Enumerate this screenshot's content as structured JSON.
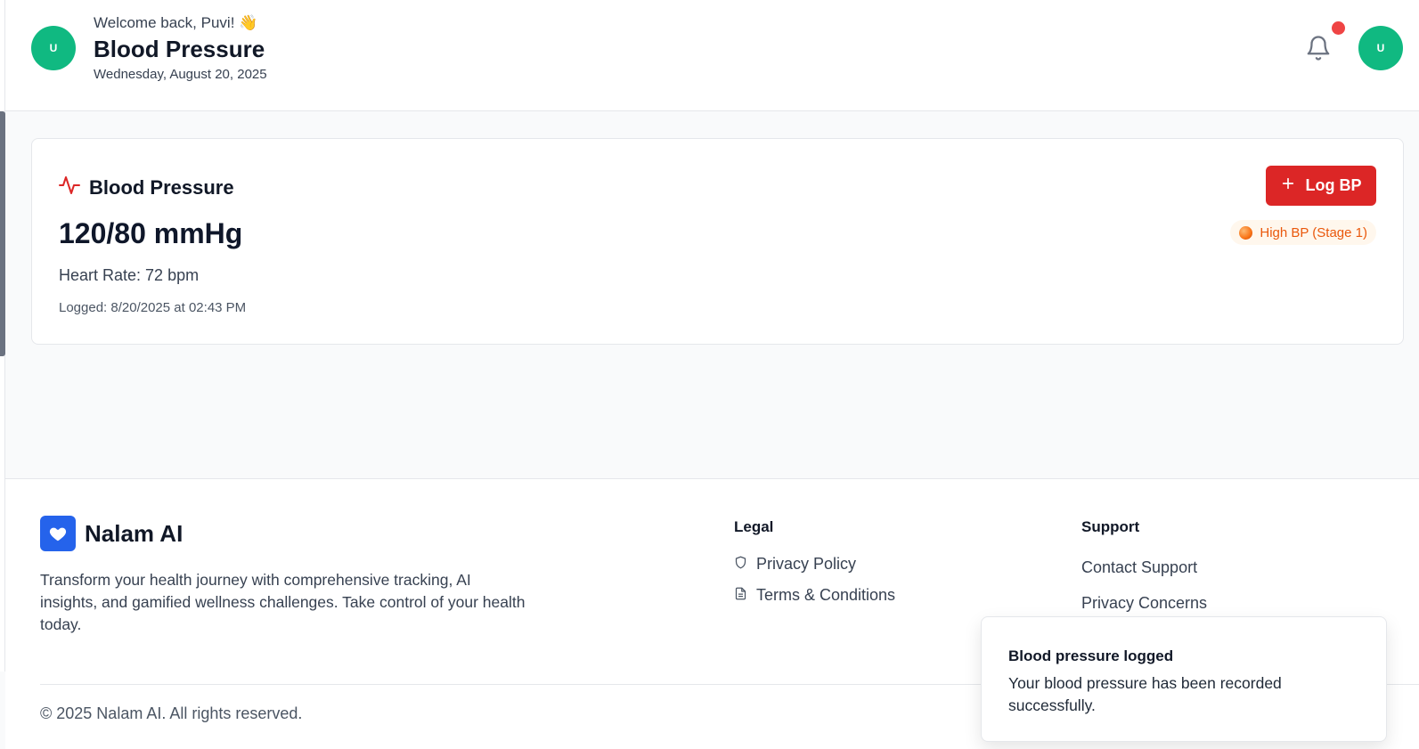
{
  "header": {
    "avatar_initial": "U",
    "welcome": "Welcome back, Puvi! 👋",
    "title": "Blood Pressure",
    "date": "Wednesday, August 20, 2025",
    "notifications_icon": "bell-icon",
    "profile_initial": "U"
  },
  "card": {
    "icon": "activity-pulse-icon",
    "heading": "Blood Pressure",
    "reading": "120/80 mmHg",
    "heart_rate": "Heart Rate: 72 bpm",
    "logged": "Logged: 8/20/2025 at 02:43 PM",
    "log_button": "Log BP",
    "status_badge": "High BP (Stage 1)"
  },
  "footer": {
    "brand_name": "Nalam AI",
    "tagline": "Transform your health journey with comprehensive tracking, AI insights, and gamified wellness challenges. Take control of your health today.",
    "legal_heading": "Legal",
    "legal_links": [
      "Privacy Policy",
      "Terms & Conditions"
    ],
    "support_heading": "Support",
    "support_links": [
      "Contact Support",
      "Privacy Concerns"
    ],
    "copyright": "© 2025 Nalam AI. All rights reserved."
  },
  "toast": {
    "title": "Blood pressure logged",
    "message": "Your blood pressure has been recorded successfully."
  },
  "colors": {
    "accent_red": "#dc2626",
    "avatar_green": "#10b981",
    "brand_blue": "#2563eb",
    "badge_orange": "#ea580c"
  }
}
